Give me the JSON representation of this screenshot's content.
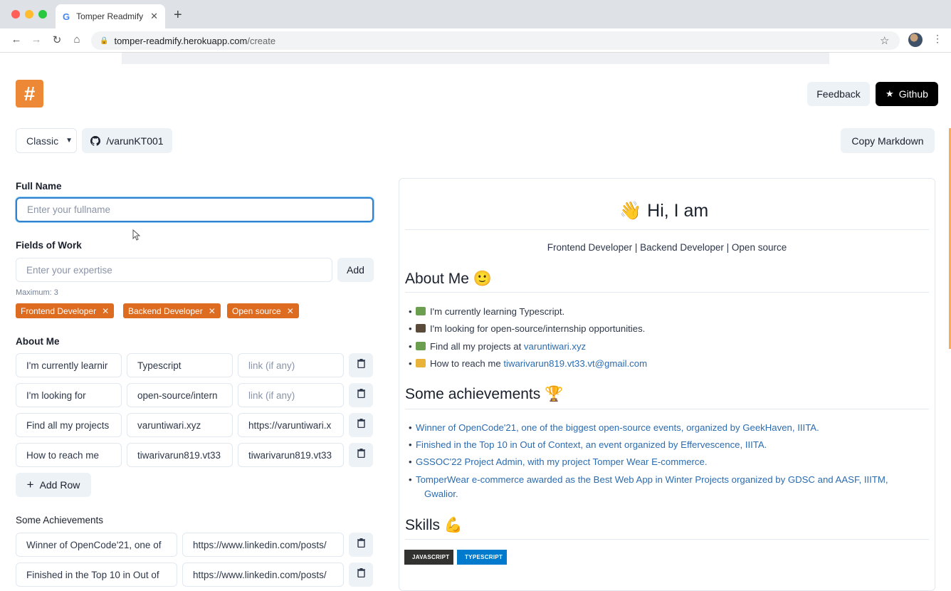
{
  "browser": {
    "tab_title": "Tomper Readmify",
    "tab_icon": "google-icon",
    "url_domain": "tomper-readmify.herokuapp.com",
    "url_path": "/create"
  },
  "header": {
    "logo_glyph": "#",
    "feedback_label": "Feedback",
    "github_label": "Github"
  },
  "controls": {
    "template_select": "Classic",
    "github_user": "/varunKT001",
    "copy_label": "Copy Markdown"
  },
  "form": {
    "fullname_label": "Full Name",
    "fullname_placeholder": "Enter your fullname",
    "fields_label": "Fields of Work",
    "expertise_placeholder": "Enter your expertise",
    "add_label": "Add",
    "maximum_note": "Maximum: 3",
    "tags": [
      "Frontend Developer",
      "Backend Developer",
      "Open source"
    ],
    "about_label": "About Me",
    "about_rows": [
      {
        "text": "I'm currently learnir",
        "value": "Typescript",
        "link": "link (if any)",
        "link_is_placeholder": true
      },
      {
        "text": "I'm looking for",
        "value": "open-source/intern",
        "link": "link (if any)",
        "link_is_placeholder": true
      },
      {
        "text": "Find all my projects",
        "value": "varuntiwari.xyz",
        "link": "https://varuntiwari.x",
        "link_is_placeholder": false
      },
      {
        "text": "How to reach me",
        "value": "tiwarivarun819.vt33",
        "link": "tiwarivarun819.vt33",
        "link_is_placeholder": false
      }
    ],
    "add_row_label": "Add Row",
    "achievements_label": "Some Achievements",
    "achievement_rows": [
      {
        "text": "Winner of OpenCode'21, one of",
        "link": "https://www.linkedin.com/posts/"
      },
      {
        "text": "Finished in the Top 10 in Out of",
        "link": "https://www.linkedin.com/posts/"
      }
    ]
  },
  "preview": {
    "title": "Hi, I am",
    "subtitle": "Frontend Developer | Backend Developer | Open source",
    "about_heading": "About Me",
    "about_items": [
      {
        "text": "I'm currently learning Typescript.",
        "link": ""
      },
      {
        "text": "I'm looking for open-source/internship opportunities.",
        "link": ""
      },
      {
        "text": "Find all my projects at ",
        "link": "varuntiwari.xyz"
      },
      {
        "text": "How to reach me ",
        "link": "tiwarivarun819.vt33.vt@gmail.com"
      }
    ],
    "achievements_heading": "Some achievements",
    "achievements": [
      "Winner of OpenCode'21, one of the biggest open-source events, organized by GeekHaven, IIITA.",
      "Finished in the Top 10 in Out of Context, an event organized by Effervescence, IIITA.",
      "GSSOC'22 Project Admin, with my project Tomper Wear E-commerce.",
      "TomperWear e-commerce awarded as the Best Web App in Winter Projects organized by GDSC and AASF, IIITM,",
      "Gwalior."
    ],
    "skills_heading": "Skills",
    "badges": [
      "JAVASCRIPT",
      "TYPESCRIPT"
    ]
  },
  "colors": {
    "accent": "#dd6b20",
    "logo": "#ed8936",
    "link": "#2b6cb0",
    "focus": "#3182ce"
  }
}
